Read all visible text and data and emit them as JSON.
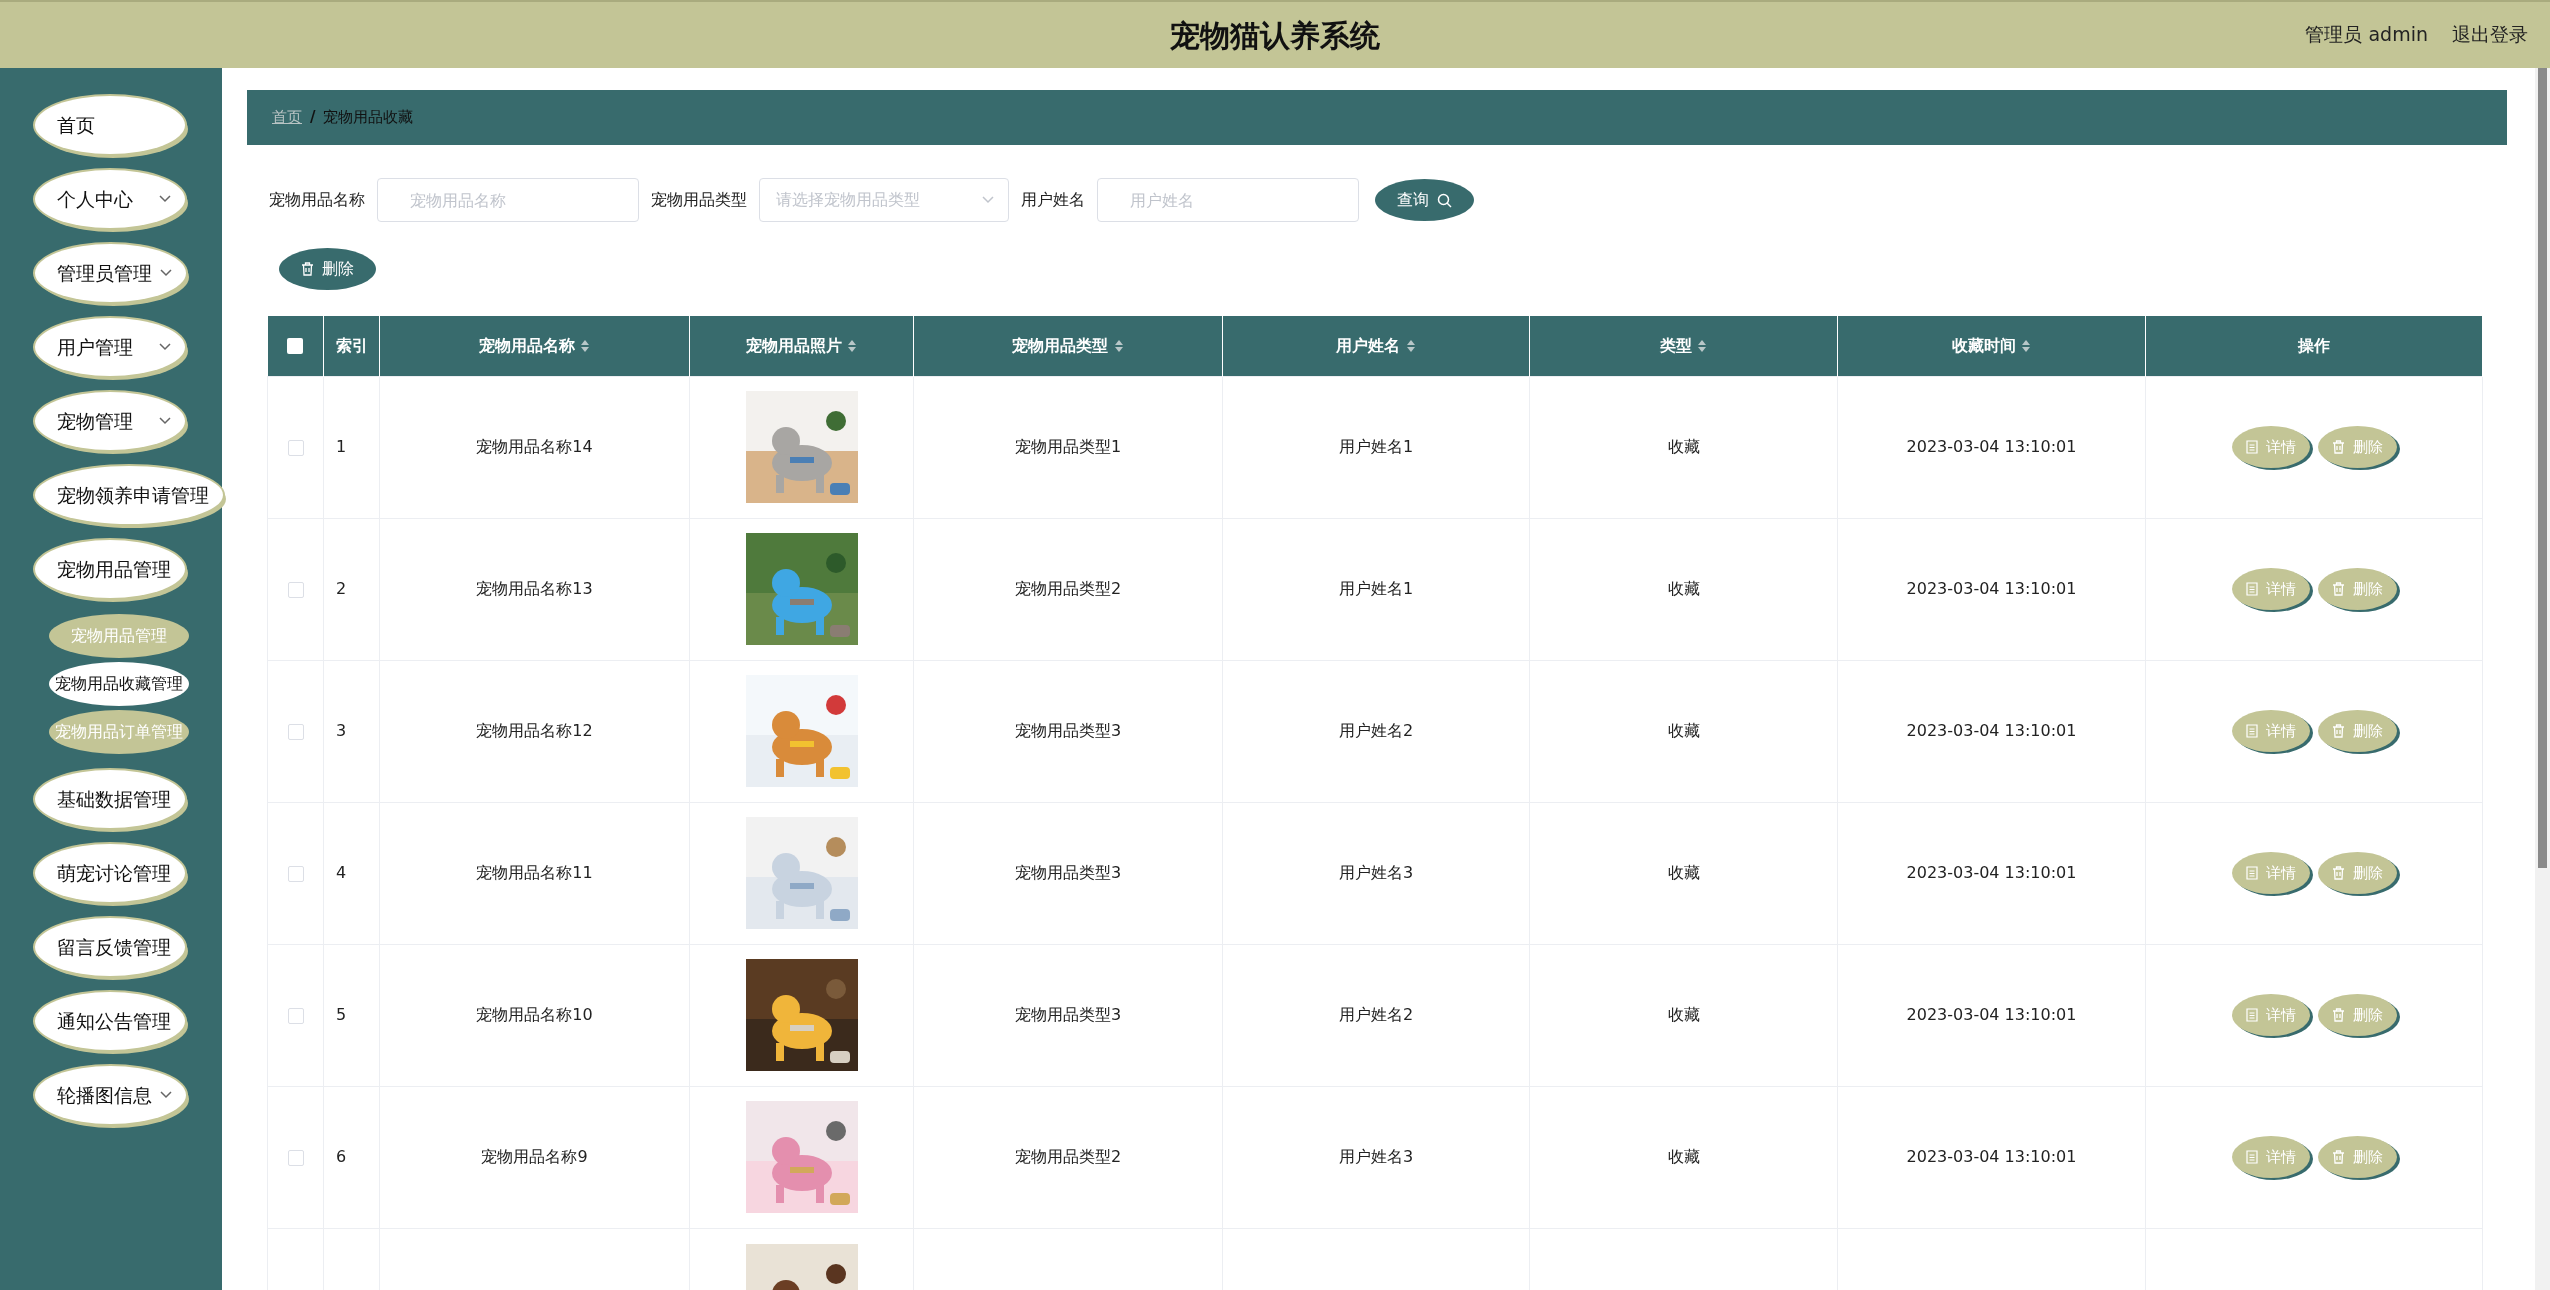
{
  "header": {
    "title": "宠物猫认养系统",
    "user": "管理员 admin",
    "logout": "退出登录"
  },
  "sidebar": {
    "items": [
      {
        "label": "首页",
        "chevron": false
      },
      {
        "label": "个人中心",
        "chevron": true
      },
      {
        "label": "管理员管理",
        "chevron": true
      },
      {
        "label": "用户管理",
        "chevron": true
      },
      {
        "label": "宠物管理",
        "chevron": true
      },
      {
        "label": "宠物领养申请管理",
        "chevron": false
      },
      {
        "label": "宠物用品管理",
        "chevron": false,
        "children": [
          {
            "label": "宠物用品管理",
            "selected": false
          },
          {
            "label": "宠物用品收藏管理",
            "selected": true
          },
          {
            "label": "宠物用品订单管理",
            "selected": false
          }
        ]
      },
      {
        "label": "基础数据管理",
        "chevron": false
      },
      {
        "label": "萌宠讨论管理",
        "chevron": false
      },
      {
        "label": "留言反馈管理",
        "chevron": false
      },
      {
        "label": "通知公告管理",
        "chevron": false
      },
      {
        "label": "轮播图信息",
        "chevron": true
      }
    ]
  },
  "breadcrumb": {
    "items": [
      "首页",
      "宠物用品收藏"
    ],
    "separator": "/"
  },
  "search": {
    "fields": [
      {
        "kind": "input",
        "label": "宠物用品名称",
        "placeholder": "宠物用品名称"
      },
      {
        "kind": "select",
        "label": "宠物用品类型",
        "placeholder": "请选择宠物用品类型"
      },
      {
        "kind": "input",
        "label": "用户姓名",
        "placeholder": "用户姓名"
      }
    ],
    "button": "查询"
  },
  "toolbar": {
    "delete": "删除"
  },
  "table": {
    "all_checked": false,
    "columns": [
      {
        "label": "索引",
        "sortable": false
      },
      {
        "label": "宠物用品名称",
        "sortable": true
      },
      {
        "label": "宠物用品照片",
        "sortable": true
      },
      {
        "label": "宠物用品类型",
        "sortable": true
      },
      {
        "label": "用户姓名",
        "sortable": true
      },
      {
        "label": "类型",
        "sortable": true
      },
      {
        "label": "收藏时间",
        "sortable": true
      },
      {
        "label": "操作",
        "sortable": false
      }
    ],
    "rows": [
      {
        "checked": false,
        "index": "1",
        "name": "宠物用品名称14",
        "photo": {
          "kind": "picture"
        },
        "type": "宠物用品类型1",
        "user": "用户姓名1",
        "category": "收藏",
        "time": "2023-03-04 13:10:01",
        "actions": [
          "详情",
          "删除"
        ]
      },
      {
        "checked": false,
        "index": "2",
        "name": "宠物用品名称13",
        "photo": {
          "kind": "picture"
        },
        "type": "宠物用品类型2",
        "user": "用户姓名1",
        "category": "收藏",
        "time": "2023-03-04 13:10:01",
        "actions": [
          "详情",
          "删除"
        ]
      },
      {
        "checked": false,
        "index": "3",
        "name": "宠物用品名称12",
        "photo": {
          "kind": "picture"
        },
        "type": "宠物用品类型3",
        "user": "用户姓名2",
        "category": "收藏",
        "time": "2023-03-04 13:10:01",
        "actions": [
          "详情",
          "删除"
        ]
      },
      {
        "checked": false,
        "index": "4",
        "name": "宠物用品名称11",
        "photo": {
          "kind": "picture"
        },
        "type": "宠物用品类型3",
        "user": "用户姓名3",
        "category": "收藏",
        "time": "2023-03-04 13:10:01",
        "actions": [
          "详情",
          "删除"
        ]
      },
      {
        "checked": false,
        "index": "5",
        "name": "宠物用品名称10",
        "photo": {
          "kind": "picture"
        },
        "type": "宠物用品类型3",
        "user": "用户姓名2",
        "category": "收藏",
        "time": "2023-03-04 13:10:01",
        "actions": [
          "详情",
          "删除"
        ]
      },
      {
        "checked": false,
        "index": "6",
        "name": "宠物用品名称9",
        "photo": {
          "kind": "picture"
        },
        "type": "宠物用品类型2",
        "user": "用户姓名3",
        "category": "收藏",
        "time": "2023-03-04 13:10:01",
        "actions": [
          "详情",
          "删除"
        ]
      },
      {
        "photo": {
          "kind": "picture"
        }
      }
    ]
  }
}
